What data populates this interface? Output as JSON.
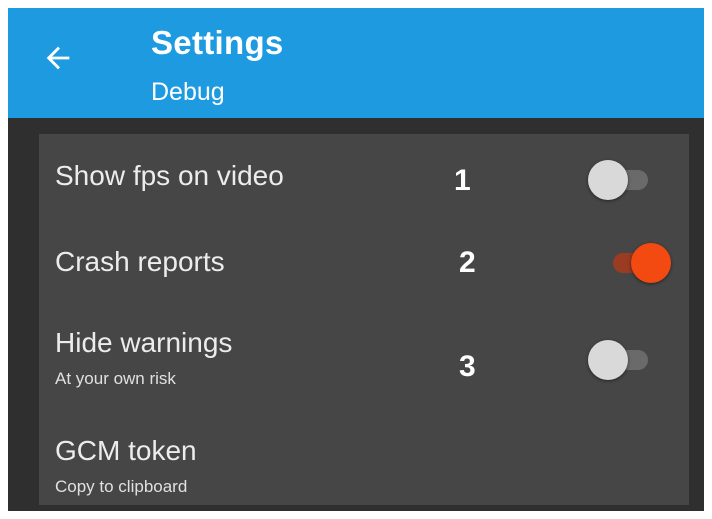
{
  "appbar": {
    "back_icon": "arrow-left-icon",
    "title": "Settings",
    "subtitle": "Debug",
    "color": "#1e9be0"
  },
  "settings": {
    "items": [
      {
        "label": "Show fps on video",
        "marker": "1",
        "toggle": "off"
      },
      {
        "label": "Crash reports",
        "marker": "2",
        "toggle": "on"
      },
      {
        "label": "Hide warnings",
        "sublabel": "At your own risk",
        "marker": "3",
        "toggle": "off"
      },
      {
        "label": "GCM token",
        "sublabel": "Copy to clipboard"
      }
    ]
  },
  "colors": {
    "screen_bg": "#2f2f2f",
    "panel_bg": "#464646",
    "accent_on": "#f24a10"
  }
}
